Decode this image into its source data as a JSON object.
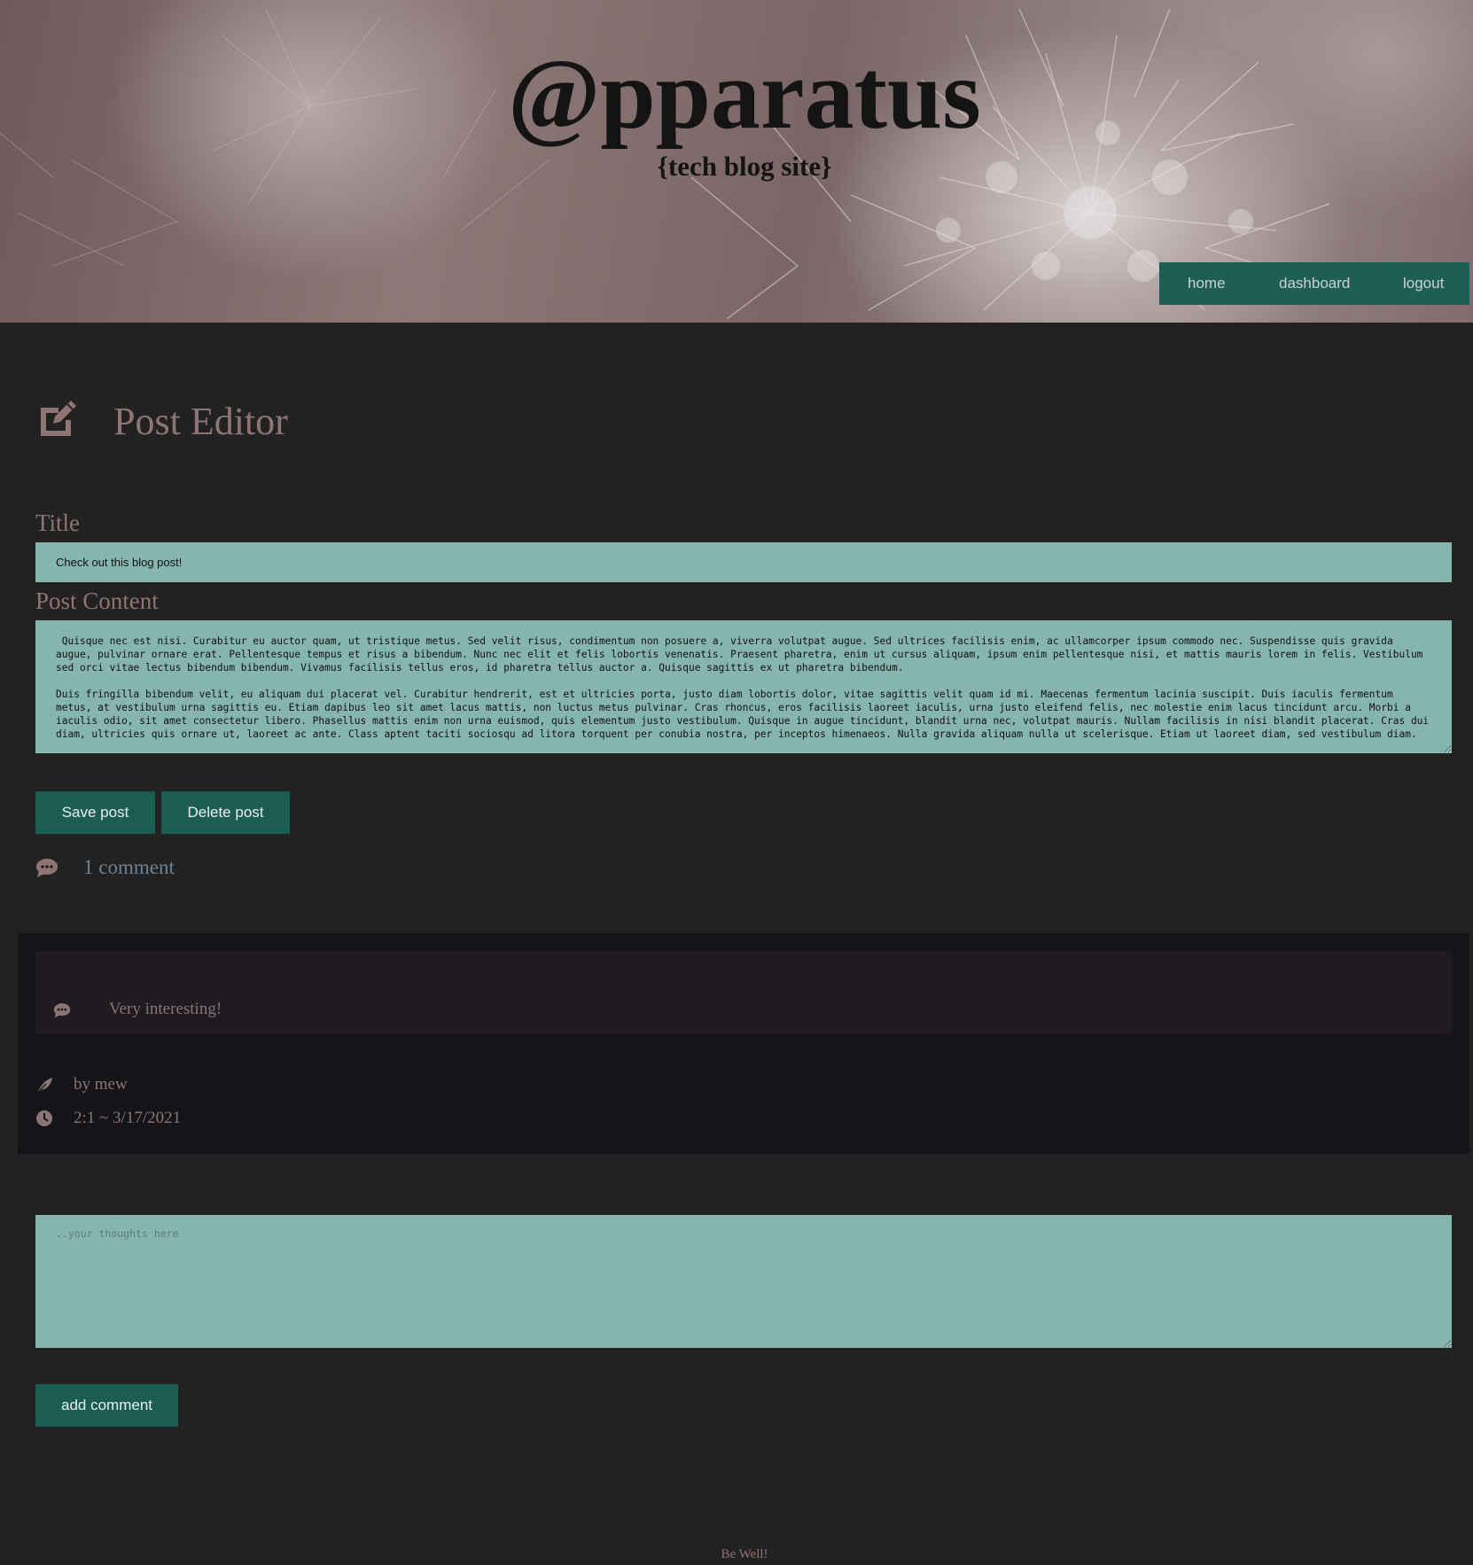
{
  "header": {
    "site_title": "@pparatus",
    "site_subtitle": "{tech blog site}",
    "nav": [
      "home",
      "dashboard",
      "logout"
    ]
  },
  "editor": {
    "heading": "Post Editor",
    "heading_icon": "edit-icon",
    "title_label": "Title",
    "title_value": "Check out this blog post!",
    "content_label": "Post Content",
    "content_value": " Quisque nec est nisi. Curabitur eu auctor quam, ut tristique metus. Sed velit risus, condimentum non posuere a, viverra volutpat augue. Sed ultrices facilisis enim, ac ullamcorper ipsum commodo nec. Suspendisse quis gravida augue, pulvinar ornare erat. Pellentesque tempus et risus a bibendum. Nunc nec elit et felis lobortis venenatis. Praesent pharetra, enim ut cursus aliquam, ipsum enim pellentesque nisi, et mattis mauris lorem in felis. Vestibulum sed orci vitae lectus bibendum bibendum. Vivamus facilisis tellus eros, id pharetra tellus auctor a. Quisque sagittis ex ut pharetra bibendum.\n\nDuis fringilla bibendum velit, eu aliquam dui placerat vel. Curabitur hendrerit, est et ultricies porta, justo diam lobortis dolor, vitae sagittis velit quam id mi. Maecenas fermentum lacinia suscipit. Duis iaculis fermentum metus, at vestibulum urna sagittis eu. Etiam dapibus leo sit amet lacus mattis, non luctus metus pulvinar. Cras rhoncus, eros facilisis laoreet iaculis, urna justo eleifend felis, nec molestie enim lacus tincidunt arcu. Morbi a iaculis odio, sit amet consectetur libero. Phasellus mattis enim non urna euismod, quis elementum justo vestibulum. Quisque in augue tincidunt, blandit urna nec, volutpat mauris. Nullam facilisis in nisi blandit placerat. Cras dui diam, ultricies quis ornare ut, laoreet ac ante. Class aptent taciti sociosqu ad litora torquent per conubia nostra, per inceptos himenaeos. Nulla gravida aliquam nulla ut scelerisque. Etiam ut laoreet diam, sed vestibulum diam.",
    "save_label": "Save post",
    "delete_label": "Delete post",
    "comment_count": "1 comment"
  },
  "comments": [
    {
      "text": "Very interesting!",
      "author": "by mew",
      "timestamp": "2:1 ~ 3/17/2021"
    }
  ],
  "new_comment": {
    "placeholder": "..your thoughts here",
    "submit_label": "add comment"
  },
  "footer": {
    "text": "Be Well!"
  },
  "colors": {
    "background": "#222222",
    "accent_teal": "#1b5d53",
    "input_bg": "#86b5b0",
    "heading_text": "#8f7474"
  }
}
